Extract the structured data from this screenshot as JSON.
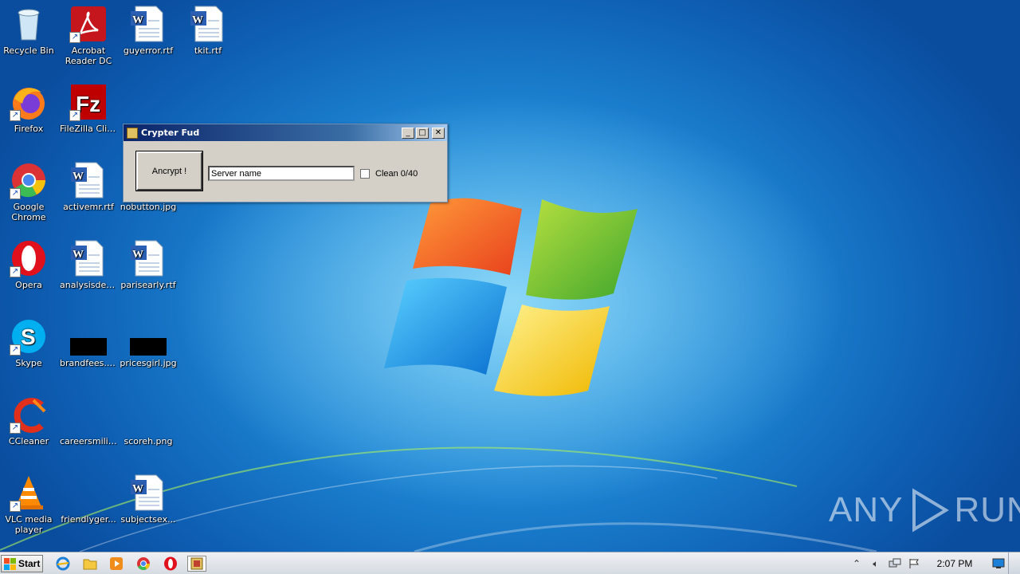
{
  "desktop": {
    "icons": [
      {
        "label": "Recycle Bin",
        "icon": "recycle-bin-icon"
      },
      {
        "label": "Acrobat Reader DC",
        "icon": "acrobat-icon"
      },
      {
        "label": "guyerror.rtf",
        "icon": "word-document-icon"
      },
      {
        "label": "tkit.rtf",
        "icon": "word-document-icon"
      },
      {
        "label": "Firefox",
        "icon": "firefox-icon"
      },
      {
        "label": "FileZilla Client",
        "icon": "filezilla-icon"
      },
      {
        "label": "Google Chrome",
        "icon": "chrome-icon"
      },
      {
        "label": "activemr.rtf",
        "icon": "word-document-icon"
      },
      {
        "label": "nobutton.jpg",
        "icon": "image-file-icon"
      },
      {
        "label": "Opera",
        "icon": "opera-icon"
      },
      {
        "label": "analysisdeal...",
        "icon": "word-document-icon"
      },
      {
        "label": "parisearly.rtf",
        "icon": "word-document-icon"
      },
      {
        "label": "Skype",
        "icon": "skype-icon"
      },
      {
        "label": "brandfees.jpg",
        "icon": "image-file-icon"
      },
      {
        "label": "pricesgirl.jpg",
        "icon": "image-file-icon"
      },
      {
        "label": "CCleaner",
        "icon": "ccleaner-icon"
      },
      {
        "label": "careersmilit...",
        "icon": "image-file-icon"
      },
      {
        "label": "scoreh.png",
        "icon": "image-file-icon"
      },
      {
        "label": "VLC media player",
        "icon": "vlc-icon"
      },
      {
        "label": "friendlyger...",
        "icon": "image-file-icon"
      },
      {
        "label": "subjectsex...",
        "icon": "word-document-icon"
      }
    ]
  },
  "window": {
    "title": "Crypter Fud",
    "encrypt_button": "Ancrypt !",
    "server_input_value": "Server name",
    "checkbox_label": "Clean 0/40",
    "checkbox_checked": false
  },
  "watermark": {
    "left": "ANY",
    "right": "RUN"
  },
  "taskbar": {
    "start_label": "Start",
    "pinned": [
      "internet-explorer-icon",
      "explorer-folder-icon",
      "media-player-icon",
      "chrome-icon",
      "opera-icon",
      "crypter-app-icon"
    ],
    "clock": "2:07 PM"
  },
  "colors": {
    "accent": "#1e86d4",
    "titlebar": "#0b246a"
  }
}
